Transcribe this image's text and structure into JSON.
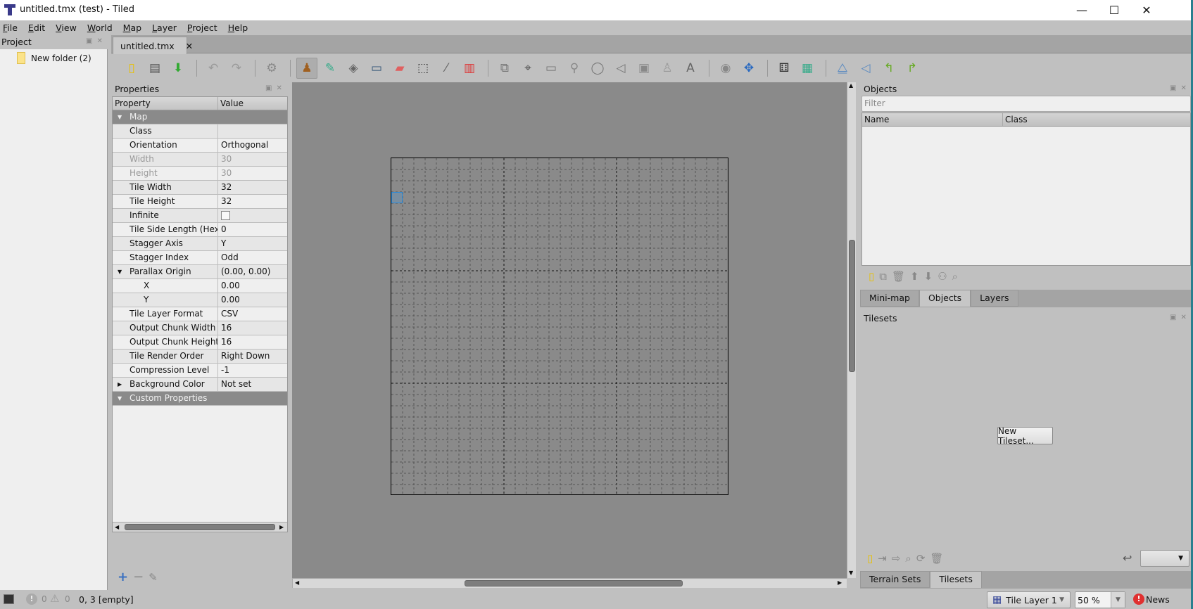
{
  "window": {
    "title": "untitled.tmx (test) - Tiled",
    "minimize": "—",
    "maximize": "☐",
    "close": "✕"
  },
  "menu": [
    "File",
    "Edit",
    "View",
    "World",
    "Map",
    "Layer",
    "Project",
    "Help"
  ],
  "project": {
    "title": "Project",
    "items": [
      {
        "label": "New folder (2)",
        "icon": "folder-icon"
      }
    ]
  },
  "document_tab": {
    "label": "untitled.tmx",
    "close": "✕"
  },
  "toolbar": {
    "icons": [
      "new-map-icon",
      "open-icon",
      "save-icon",
      "undo-icon",
      "redo-icon",
      "commands-icon",
      "stamp-brush-icon",
      "terrain-brush-icon",
      "bucket-fill-icon",
      "shape-fill-icon",
      "eraser-icon",
      "rectangular-select-icon",
      "magic-wand-icon",
      "select-same-tile-icon",
      "select-objects-icon",
      "edit-polygons-icon",
      "insert-rectangle-icon",
      "insert-point-icon",
      "insert-ellipse-icon",
      "insert-polygon-icon",
      "insert-tile-icon",
      "insert-template-icon",
      "insert-text-icon",
      "world-tool-icon",
      "move-icon",
      "random-mode-icon",
      "wang-fill-icon",
      "flip-horizontal-icon",
      "flip-vertical-icon",
      "rotate-left-icon",
      "rotate-right-icon"
    ],
    "selected": "stamp-brush-icon"
  },
  "properties": {
    "title": "Properties",
    "headers": [
      "Property",
      "Value"
    ],
    "rows": [
      {
        "k": "Map",
        "v": "",
        "type": "group"
      },
      {
        "k": "Class",
        "v": ""
      },
      {
        "k": "Orientation",
        "v": "Orthogonal"
      },
      {
        "k": "Width",
        "v": "30",
        "disabled": true
      },
      {
        "k": "Height",
        "v": "30",
        "disabled": true
      },
      {
        "k": "Tile Width",
        "v": "32"
      },
      {
        "k": "Tile Height",
        "v": "32"
      },
      {
        "k": "Infinite",
        "v": "",
        "checkbox": false
      },
      {
        "k": "Tile Side Length (Hex)",
        "v": "0"
      },
      {
        "k": "Stagger Axis",
        "v": "Y"
      },
      {
        "k": "Stagger Index",
        "v": "Odd"
      },
      {
        "k": "Parallax Origin",
        "v": "(0.00, 0.00)",
        "expanded": true
      },
      {
        "k": "X",
        "v": "0.00",
        "type": "sub"
      },
      {
        "k": "Y",
        "v": "0.00",
        "type": "sub"
      },
      {
        "k": "Tile Layer Format",
        "v": "CSV"
      },
      {
        "k": "Output Chunk Width",
        "v": "16"
      },
      {
        "k": "Output Chunk Height",
        "v": "16"
      },
      {
        "k": "Tile Render Order",
        "v": "Right Down"
      },
      {
        "k": "Compression Level",
        "v": "-1"
      },
      {
        "k": "Background Color",
        "v": "Not set",
        "expanded": false
      },
      {
        "k": "Custom Properties",
        "v": "",
        "type": "group"
      }
    ],
    "buttons": {
      "add": "+",
      "remove": "−",
      "rename": "✎"
    }
  },
  "map": {
    "width_tiles": 30,
    "height_tiles": 30,
    "major_grid_every": 10,
    "hover_tile": [
      0,
      3
    ],
    "hover_color": "#2a8ad8"
  },
  "objects": {
    "title": "Objects",
    "filter_placeholder": "Filter",
    "headers": [
      "Name",
      "Class"
    ]
  },
  "right_tabs": {
    "items": [
      "Mini-map",
      "Objects",
      "Layers"
    ],
    "active": "Objects"
  },
  "tilesets": {
    "title": "Tilesets",
    "new_button": "New Tileset...",
    "bottom_tabs": [
      "Terrain Sets",
      "Tilesets"
    ],
    "active": "Tilesets"
  },
  "status": {
    "errors": "0",
    "warnings": "0",
    "position": "0, 3 [empty]",
    "layer": "Tile Layer 1",
    "zoom": "50 %",
    "news": "News",
    "news_color": "#e03030"
  }
}
